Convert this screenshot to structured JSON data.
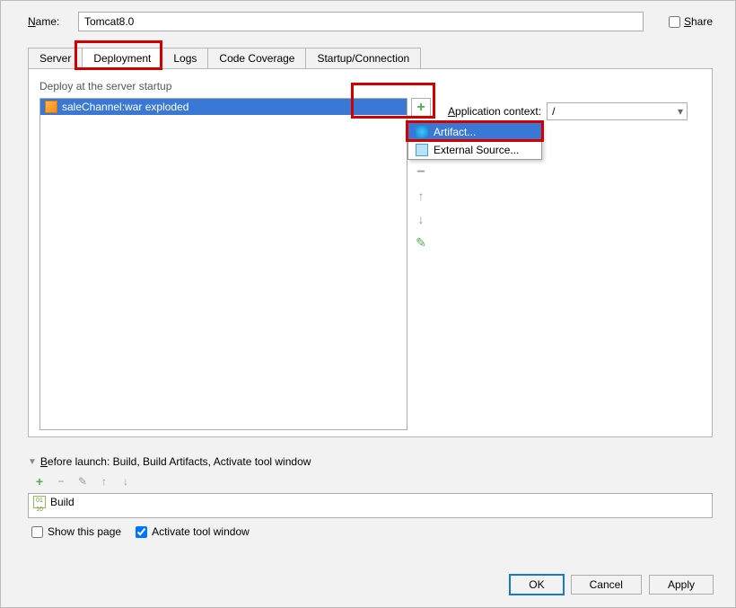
{
  "name": {
    "label": "Name:",
    "value": "Tomcat8.0"
  },
  "share": {
    "label": "Share",
    "checked": false
  },
  "tabs": {
    "server": "Server",
    "deployment": "Deployment",
    "logs": "Logs",
    "coverage": "Code Coverage",
    "startup": "Startup/Connection"
  },
  "deploy": {
    "header": "Deploy at the server startup",
    "items": [
      "saleChannel:war exploded"
    ]
  },
  "popup": {
    "artifact": "Artifact...",
    "external": "External Source..."
  },
  "context": {
    "label": "Application context:",
    "value": "/"
  },
  "beforeLaunch": {
    "title": "Before launch: Build, Build Artifacts, Activate tool window",
    "items": [
      "Build"
    ]
  },
  "footer": {
    "showPage": {
      "label": "Show this page",
      "checked": false
    },
    "activate": {
      "label": "Activate tool window",
      "checked": true
    }
  },
  "buttons": {
    "ok": "OK",
    "cancel": "Cancel",
    "apply": "Apply"
  }
}
